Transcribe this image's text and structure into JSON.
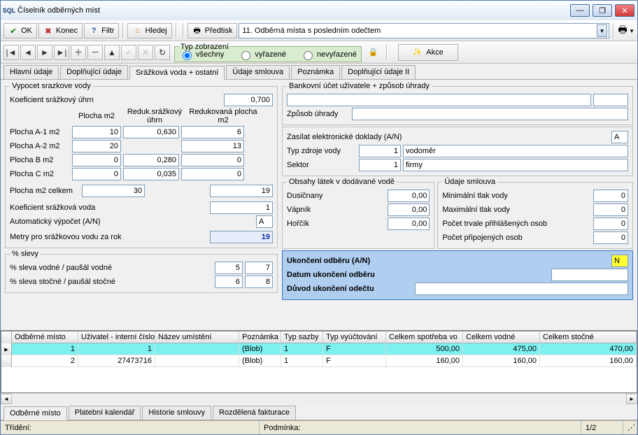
{
  "window": {
    "title": "Číselník odběrných míst"
  },
  "toolbar": {
    "ok": "OK",
    "konec": "Konec",
    "filtr": "Filtr",
    "hledej": "Hledej",
    "predtisk": "Předtisk",
    "predtisk_dd": "11. Odběrná místa s posledním odečtem"
  },
  "navbar": {
    "zobrazeni_legend": "Typ zobrazení",
    "vsechny": "všechny",
    "vyrazene": "vyřazené",
    "nevyrazene": "nevyřazené",
    "akce": "Akce"
  },
  "tabs": {
    "hlavni": "Hlavní údaje",
    "dopln": "Doplňující údaje",
    "srazkova": "Srážková voda + ostatní",
    "smlouva": "Údaje smlouva",
    "poznamka": "Poznámka",
    "dopln2": "Doplňující údaje II"
  },
  "left": {
    "vypocet_legend": "Vypocet srazkove vody",
    "koef_uhrn_lbl": "Koeficient srážkový úhrn",
    "koef_uhrn_val": "0,700",
    "h_plocha": "Plocha m2",
    "h_reduk": "Reduk.srážkový úhrn",
    "h_redplocha": "Redukovaná plocha m2",
    "a1_lbl": "Plocha A-1 m2",
    "a1_p": "10",
    "a1_r": "0,630",
    "a1_rp": "6",
    "a2_lbl": "Plocha A-2 m2",
    "a2_p": "20",
    "a2_r": "",
    "a2_rp": "13",
    "b_lbl": "Plocha B m2",
    "b_p": "0",
    "b_r": "0,280",
    "b_rp": "0",
    "c_lbl": "Plocha C m2",
    "c_p": "0",
    "c_r": "0,035",
    "c_rp": "0",
    "celkem_lbl": "Plocha m2 celkem",
    "celkem_p": "30",
    "celkem_rp": "19",
    "koef_voda_lbl": "Koeficient srážková voda",
    "koef_voda_val": "1",
    "auto_lbl": "Automatický výpočet (A/N)",
    "auto_val": "A",
    "metry_lbl": "Metry pro srážkovou vodu za rok",
    "metry_val": "19",
    "slevy_legend": "% slevy",
    "sleva_vodne_lbl": "% sleva vodné / paušál vodné",
    "sleva_vodne_a": "5",
    "sleva_vodne_b": "7",
    "sleva_stocne_lbl": "% sleva stočné / paušál stočné",
    "sleva_stocne_a": "6",
    "sleva_stocne_b": "8"
  },
  "right": {
    "bank_legend": "Bankovní účet uživatele + způsob úhrady",
    "zpusob_lbl": "Způsob úhrady",
    "zasilat_lbl": "Zasílat elektronické doklady (A/N)",
    "zasilat_val": "A",
    "typ_zdroj_lbl": "Typ zdroje vody",
    "typ_zdroj_num": "1",
    "typ_zdroj_txt": "vodoměr",
    "sektor_lbl": "Sektor",
    "sektor_num": "1",
    "sektor_txt": "firmy",
    "obsahy_legend": "Obsahy látek v dodávané vodě",
    "dusic_lbl": "Dusičnany",
    "dusic_val": "0,00",
    "vapnik_lbl": "Vápník",
    "vapnik_val": "0,00",
    "horcik_lbl": "Hořčík",
    "horcik_val": "0,00",
    "smlouva_legend": "Údaje smlouva",
    "min_tlak_lbl": "Minimální tlak vody",
    "min_tlak_val": "0",
    "max_tlak_lbl": "Maximální tlak vody",
    "max_tlak_val": "0",
    "trvale_lbl": "Počet trvale přihlášených osob",
    "trvale_val": "0",
    "pripoj_lbl": "Počet připojených osob",
    "pripoj_val": "0",
    "uk_an_lbl": "Ukončení odběru (A/N)",
    "uk_an_val": "N",
    "uk_datum_lbl": "Datum ukončení odběru",
    "uk_duvod_lbl": "Důvod ukončení odečtu"
  },
  "grid": {
    "headers": {
      "misto": "Odběrné místo",
      "uzivatel": "Uživatel - interní číslo",
      "nazev": "Název umístění",
      "pozn": "Poznámka",
      "sazba": "Typ sazby",
      "vyuct": "Typ vyúčtování",
      "spotreba": "Celkem spotřeba vo",
      "vodne": "Celkem vodné",
      "stocne": "Celkem stočné"
    },
    "rows": [
      {
        "misto": "1",
        "uziv": "1",
        "nazev": "",
        "pozn": "(Blob)",
        "sazba": "1",
        "vyuct": "F",
        "spot": "500,00",
        "vodne": "475,00",
        "stocne": "470,00"
      },
      {
        "misto": "2",
        "uziv": "27473716",
        "nazev": "",
        "pozn": "(Blob)",
        "sazba": "1",
        "vyuct": "F",
        "spot": "160,00",
        "vodne": "160,00",
        "stocne": "160,00"
      }
    ]
  },
  "bottom_tabs": {
    "misto": "Odběrné místo",
    "kalendar": "Platební kalendář",
    "historie": "Historie smlouvy",
    "rozdel": "Rozdělená fakturace"
  },
  "status": {
    "trideni": "Třídění:",
    "podminka": "Podmínka:",
    "counter": "1/2"
  }
}
